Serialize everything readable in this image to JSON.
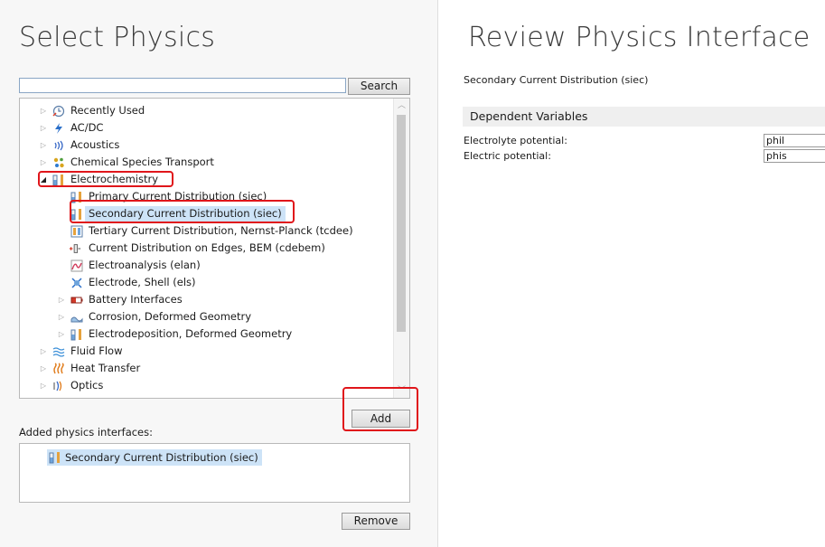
{
  "left": {
    "title": "Select Physics",
    "search": {
      "value": "",
      "placeholder": "",
      "button_label": "Search"
    },
    "tree": [
      {
        "label": "Recently Used",
        "expanded": false,
        "icon": "clock-icon"
      },
      {
        "label": "AC/DC",
        "expanded": false,
        "icon": "acdc-icon"
      },
      {
        "label": "Acoustics",
        "expanded": false,
        "icon": "acoustics-icon"
      },
      {
        "label": "Chemical Species Transport",
        "expanded": false,
        "icon": "molecules-icon"
      },
      {
        "label": "Electrochemistry",
        "expanded": true,
        "icon": "electrochemistry-icon",
        "highlighted": true
      },
      {
        "label": "Primary Current Distribution (siec)",
        "icon": "electrochemistry-icon"
      },
      {
        "label": "Secondary Current Distribution (siec)",
        "icon": "electrochemistry-icon",
        "selected": true,
        "highlighted": true
      },
      {
        "label": "Tertiary Current Distribution, Nernst-Planck (tcdee)",
        "icon": "tertiary-icon"
      },
      {
        "label": "Current Distribution on Edges, BEM (cdebem)",
        "icon": "edges-bem-icon"
      },
      {
        "label": "Electroanalysis (elan)",
        "icon": "electroanalysis-icon"
      },
      {
        "label": "Electrode, Shell (els)",
        "icon": "electrode-shell-icon"
      },
      {
        "label": "Battery Interfaces",
        "expanded": false,
        "icon": "battery-icon"
      },
      {
        "label": "Corrosion, Deformed Geometry",
        "expanded": false,
        "icon": "corrosion-icon"
      },
      {
        "label": "Electrodeposition, Deformed Geometry",
        "expanded": false,
        "icon": "electrochemistry-icon"
      },
      {
        "label": "Fluid Flow",
        "expanded": false,
        "icon": "fluid-flow-icon"
      },
      {
        "label": "Heat Transfer",
        "expanded": false,
        "icon": "heat-transfer-icon"
      },
      {
        "label": "Optics",
        "expanded": false,
        "icon": "optics-icon"
      }
    ],
    "add_button": "Add",
    "added_label": "Added physics interfaces:",
    "added_items": [
      "Secondary Current Distribution (siec)"
    ],
    "remove_button": "Remove"
  },
  "right": {
    "title": "Review Physics Interface",
    "interface_name": "Secondary Current Distribution (siec)",
    "section_header": "Dependent Variables",
    "variables": [
      {
        "label": "Electrolyte potential:",
        "value": "phil"
      },
      {
        "label": "Electric potential:",
        "value": "phis"
      }
    ]
  },
  "colors": {
    "highlight": "#e0161b",
    "selection": "#cde3f7",
    "header_bg": "#efefef"
  }
}
